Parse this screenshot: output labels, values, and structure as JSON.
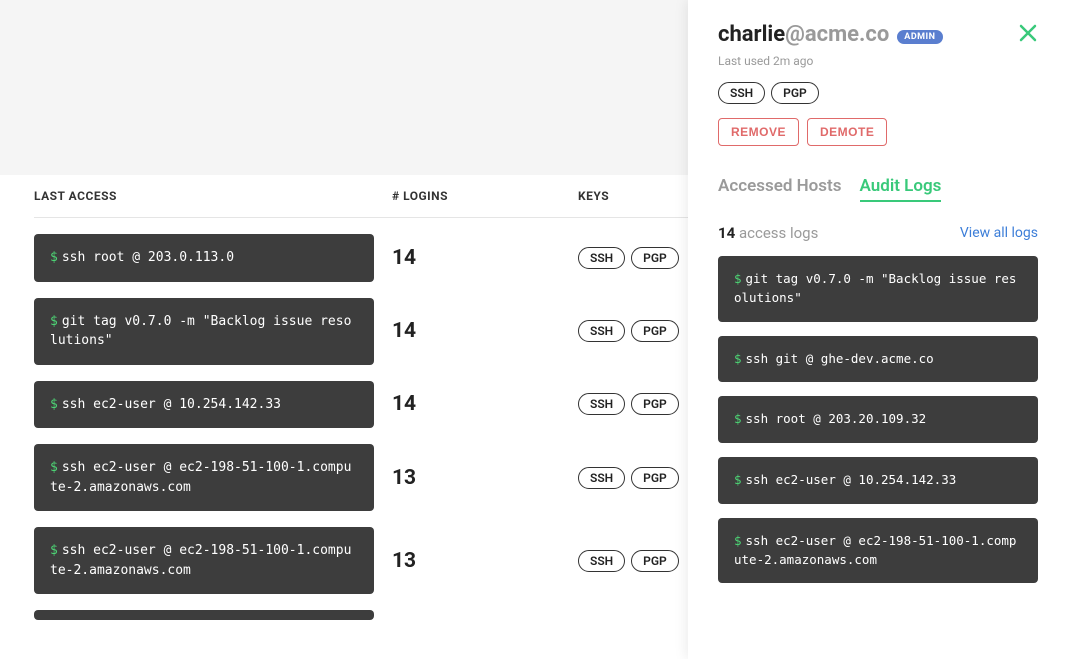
{
  "colors": {
    "accent_green": "#39c97a",
    "danger_red": "#e06a6a",
    "badge_blue": "#5a7ecf",
    "cmd_bg": "#3d3d3d"
  },
  "table": {
    "headers": {
      "last_access": "LAST ACCESS",
      "logins": "# LOGINS",
      "keys": "KEYS"
    },
    "rows": [
      {
        "cmd": "ssh root @ 203.0.113.0",
        "logins": "14",
        "keys": [
          "SSH",
          "PGP"
        ]
      },
      {
        "cmd": "git tag v0.7.0 -m \"Backlog issue resolutions\"",
        "logins": "14",
        "keys": [
          "SSH",
          "PGP"
        ]
      },
      {
        "cmd": "ssh ec2-user @ 10.254.142.33",
        "logins": "14",
        "keys": [
          "SSH",
          "PGP"
        ]
      },
      {
        "cmd": "ssh ec2-user @ ec2-198-51-100-1.compute-2.amazonaws.com",
        "logins": "13",
        "keys": [
          "SSH",
          "PGP"
        ]
      },
      {
        "cmd": "ssh ec2-user @ ec2-198-51-100-1.compute-2.amazonaws.com",
        "logins": "13",
        "keys": [
          "SSH",
          "PGP"
        ]
      }
    ]
  },
  "panel": {
    "user": {
      "local": "charlie",
      "domain": "@acme.co",
      "role_badge": "ADMIN"
    },
    "last_used": "Last used 2m ago",
    "keys": [
      "SSH",
      "PGP"
    ],
    "actions": {
      "remove": "REMOVE",
      "demote": "DEMOTE"
    },
    "tabs": {
      "accessed_hosts": "Accessed Hosts",
      "audit_logs": "Audit Logs"
    },
    "logs_summary": {
      "count": "14",
      "label": "access logs",
      "view_all": "View all logs"
    },
    "logs": [
      "git tag v0.7.0 -m \"Backlog issue resolutions\"",
      "ssh git @ ghe-dev.acme.co",
      "ssh root @ 203.20.109.32",
      "ssh ec2-user @ 10.254.142.33",
      "ssh ec2-user @ ec2-198-51-100-1.compute-2.amazonaws.com"
    ]
  },
  "glyphs": {
    "prompt": "$"
  }
}
